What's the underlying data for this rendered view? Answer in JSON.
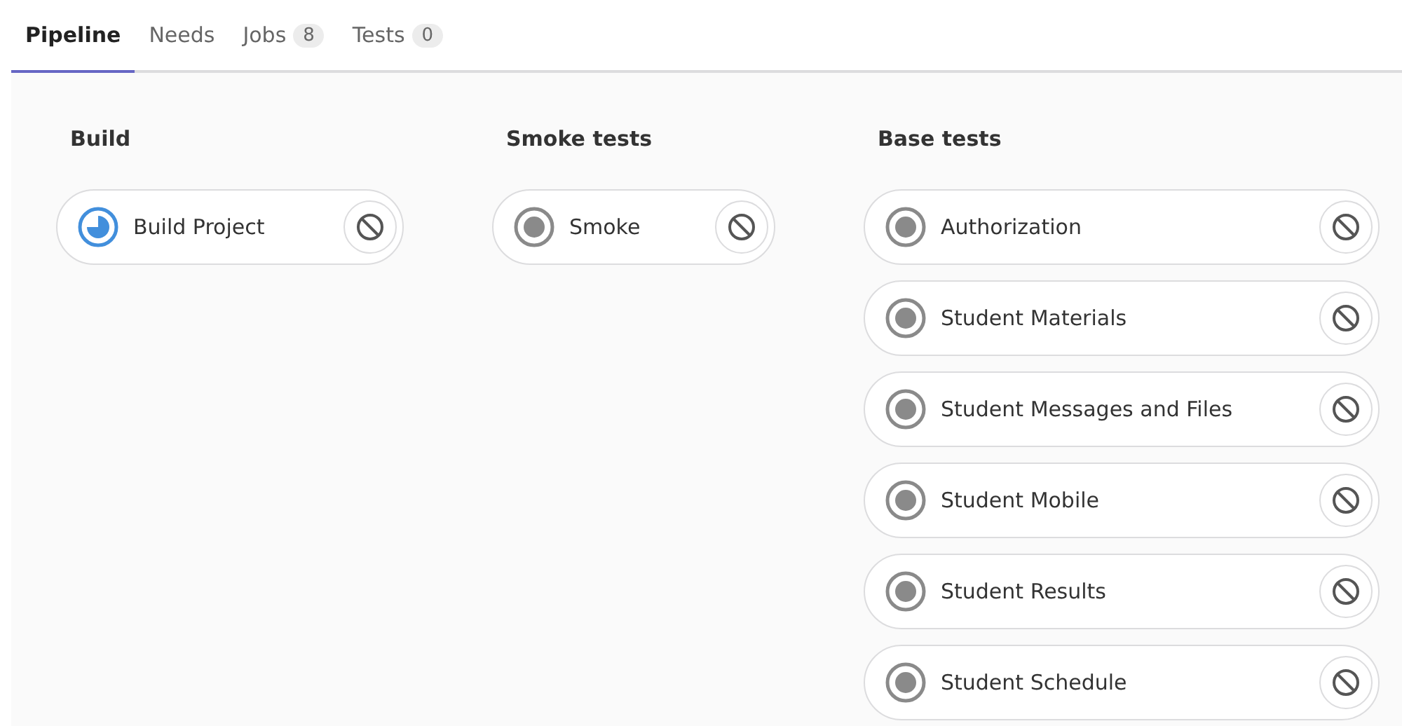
{
  "tabs": [
    {
      "label": "Pipeline",
      "selected": true
    },
    {
      "label": "Needs",
      "selected": false
    },
    {
      "label": "Jobs",
      "count": "8",
      "selected": false
    },
    {
      "label": "Tests",
      "count": "0",
      "selected": false
    }
  ],
  "stages": [
    {
      "title": "Build",
      "jobs": [
        {
          "name": "Build Project",
          "kind": "running"
        }
      ]
    },
    {
      "title": "Smoke tests",
      "jobs": [
        {
          "name": "Smoke",
          "kind": "created"
        }
      ]
    },
    {
      "title": "Base tests",
      "jobs": [
        {
          "name": "Authorization",
          "kind": "created"
        },
        {
          "name": "Student Materials",
          "kind": "created"
        },
        {
          "name": "Student Messages and Files",
          "kind": "created"
        },
        {
          "name": "Student Mobile",
          "kind": "created"
        },
        {
          "name": "Student Results",
          "kind": "created"
        },
        {
          "name": "Student Schedule",
          "kind": "created"
        }
      ]
    }
  ]
}
